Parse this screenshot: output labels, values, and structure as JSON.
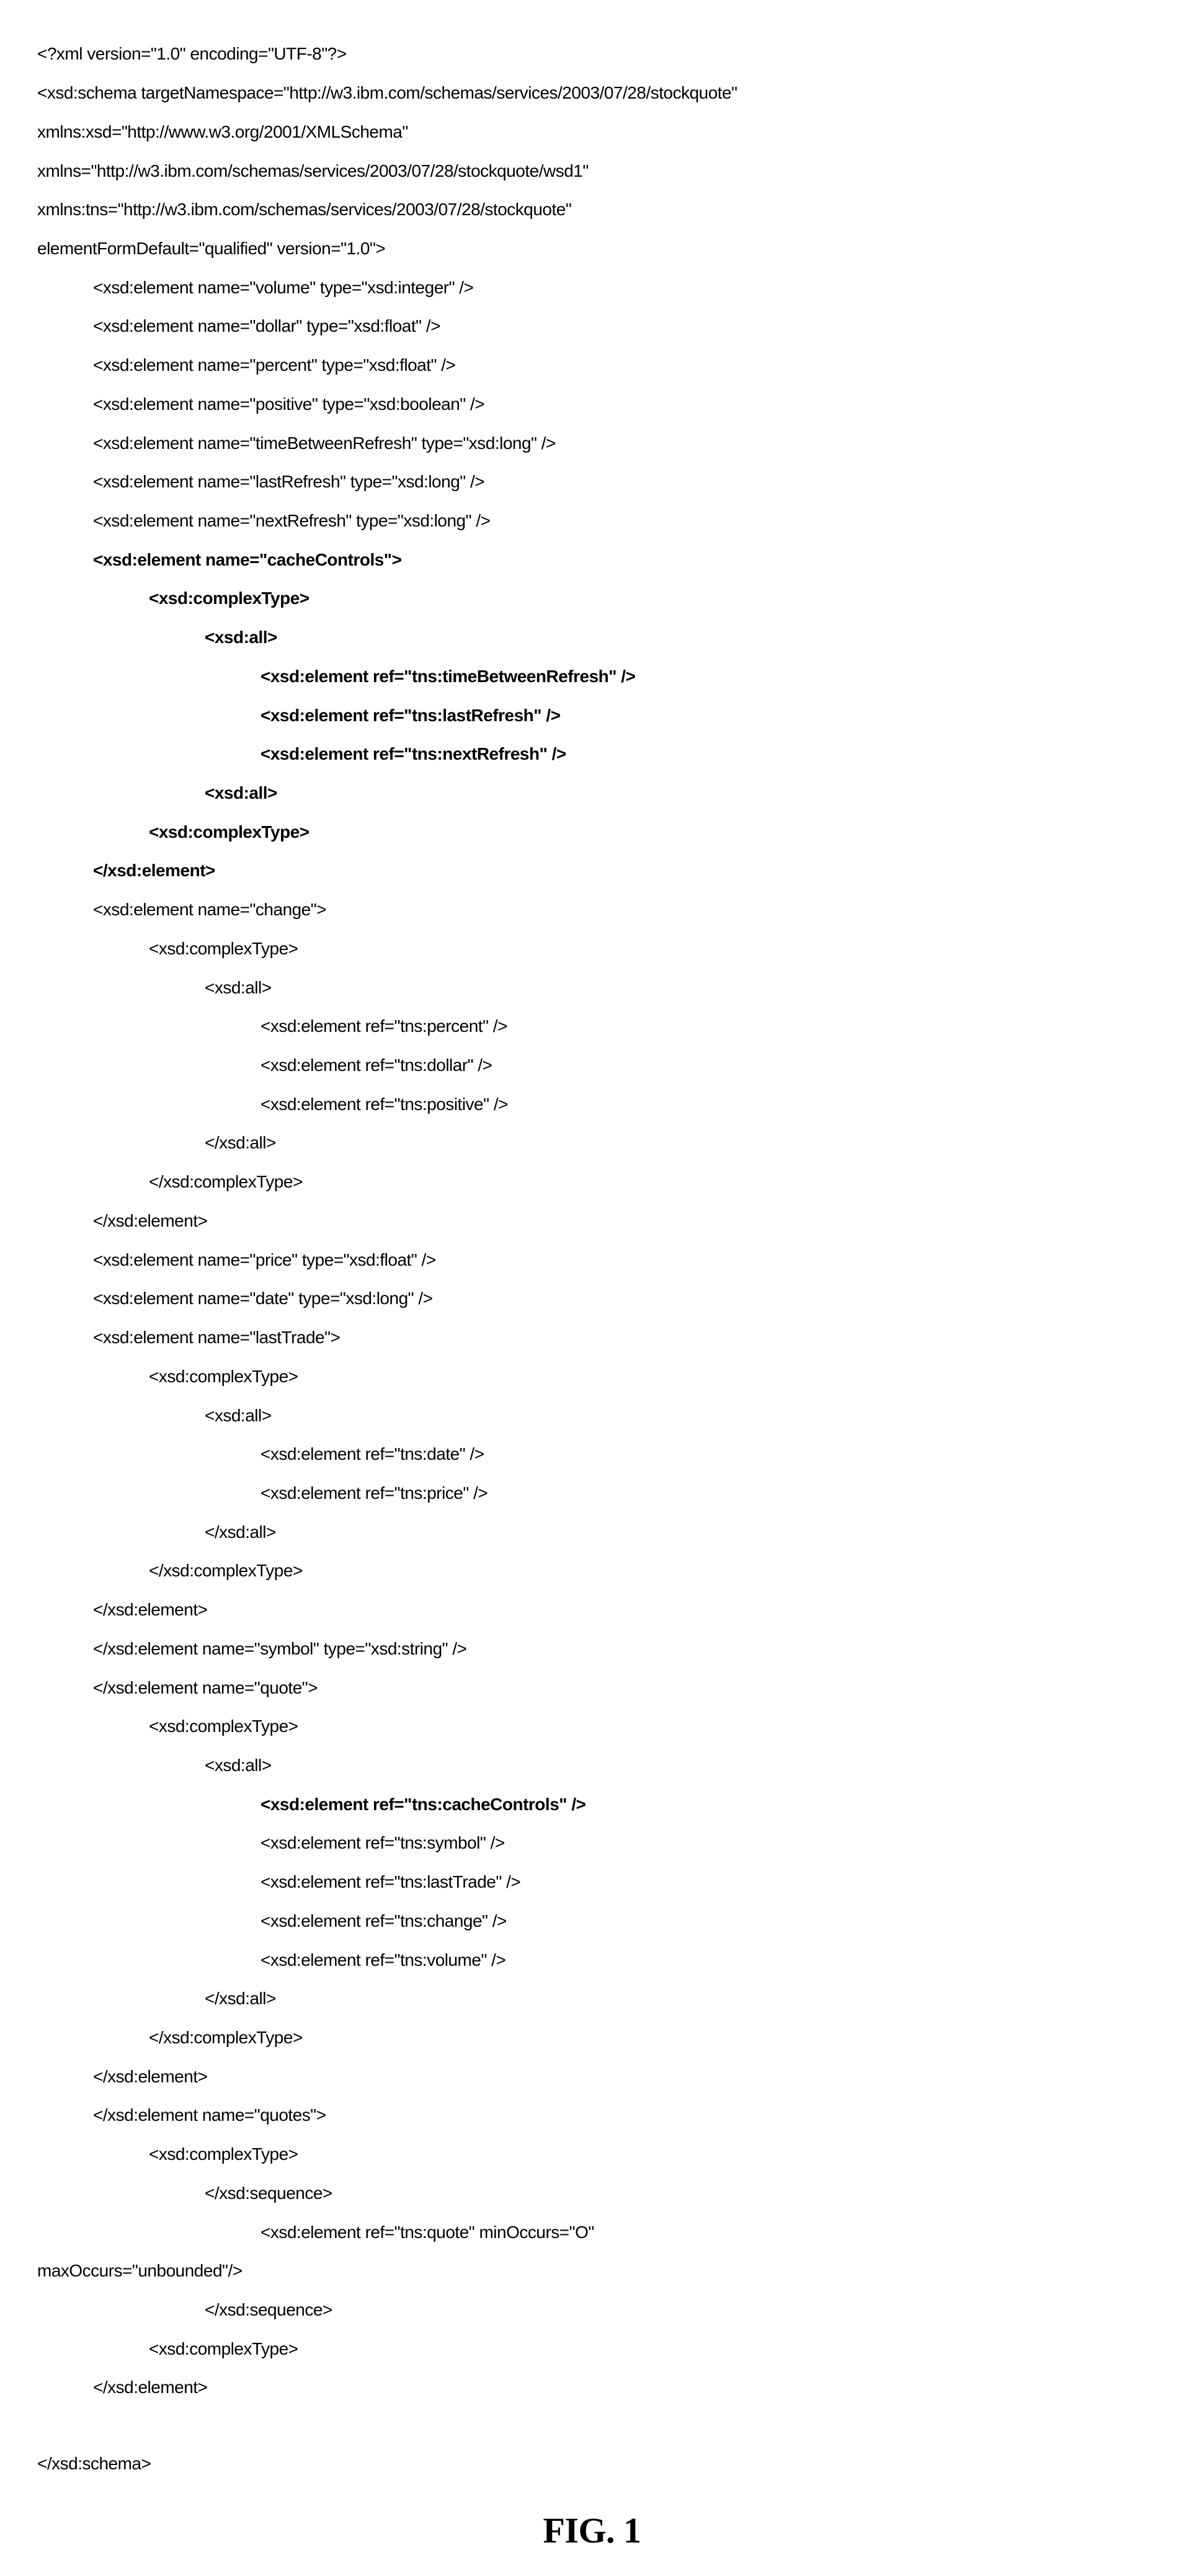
{
  "xml_decl": "<?xml version=\"1.0\" encoding=\"UTF-8\"?>",
  "schema_open_1": "<xsd:schema targetNamespace=\"http://w3.ibm.com/schemas/services/2003/07/28/stockquote\"",
  "schema_open_2": "xmlns:xsd=\"http://www.w3.org/2001/XMLSchema\"",
  "schema_open_3": "xmlns=\"http://w3.ibm.com/schemas/services/2003/07/28/stockquote/wsd1\"",
  "schema_open_4": "xmlns:tns=\"http://w3.ibm.com/schemas/services/2003/07/28/stockquote\"",
  "schema_open_5": "elementFormDefault=\"qualified\" version=\"1.0\">",
  "el_volume": "<xsd:element name=\"volume\" type=\"xsd:integer\" />",
  "el_dollar": "<xsd:element name=\"dollar\" type=\"xsd:float\" />",
  "el_percent": "<xsd:element name=\"percent\" type=\"xsd:float\" />",
  "el_positive": "<xsd:element name=\"positive\" type=\"xsd:boolean\" />",
  "el_tbr": "<xsd:element name=\"timeBetweenRefresh\" type=\"xsd:long\" />",
  "el_lastrefresh": "<xsd:element name=\"lastRefresh\" type=\"xsd:long\" />",
  "el_nextrefresh": "<xsd:element name=\"nextRefresh\" type=\"xsd:long\" />",
  "el_cachecontrols_open": "<xsd:element name=\"cacheControls\">",
  "complextype_open": "<xsd:complexType>",
  "all_open": "<xsd:all>",
  "ref_tbr": "<xsd:element ref=\"tns:timeBetweenRefresh\" />",
  "ref_lastrefresh": "<xsd:element ref=\"tns:lastRefresh\" />",
  "ref_nextrefresh": "<xsd:element ref=\"tns:nextRefresh\" />",
  "all_close_typo": "<xsd:all>",
  "complextype_close_typo": "<xsd:complexType>",
  "element_close": "</xsd:element>",
  "el_change_open": "<xsd:element name=\"change\">",
  "ref_percent": "<xsd:element ref=\"tns:percent\" />",
  "ref_dollar": "<xsd:element ref=\"tns:dollar\" />",
  "ref_positive": "<xsd:element ref=\"tns:positive\" />",
  "all_close": "</xsd:all>",
  "complextype_close": "</xsd:complexType>",
  "el_price": "<xsd:element name=\"price\" type=\"xsd:float\" />",
  "el_date": "<xsd:element name=\"date\" type=\"xsd:long\" />",
  "el_lasttrade_open": "<xsd:element name=\"lastTrade\">",
  "ref_date": "<xsd:element ref=\"tns:date\" />",
  "ref_price": "<xsd:element ref=\"tns:price\" />",
  "el_symbol": "</xsd:element name=\"symbol\" type=\"xsd:string\" />",
  "el_quote_open": "</xsd:element name=\"quote\">",
  "ref_cachecontrols": "<xsd:element ref=\"tns:cacheControls\" />",
  "ref_symbol": "<xsd:element ref=\"tns:symbol\" />",
  "ref_lasttrade": "<xsd:element ref=\"tns:lastTrade\" />",
  "ref_change": "<xsd:element ref=\"tns:change\" />",
  "ref_volume": "<xsd:element ref=\"tns:volume\" />",
  "el_quotes_open": "</xsd:element name=\"quotes\">",
  "sequence_close": "</xsd:sequence>",
  "ref_quote_1": "<xsd:element ref=\"tns:quote\" minOccurs=\"O\"",
  "ref_quote_2": "maxOccurs=\"unbounded\"/>",
  "sequence_close2": "</xsd:sequence>",
  "schema_close": "</xsd:schema>",
  "figure": "FIG. 1"
}
